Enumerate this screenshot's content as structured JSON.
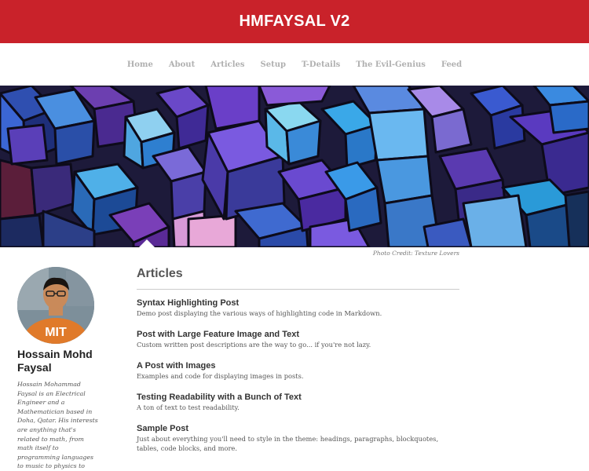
{
  "header": {
    "site_title": "HMFAYSAL V2"
  },
  "nav": {
    "items": [
      {
        "label": "Home"
      },
      {
        "label": "About"
      },
      {
        "label": "Articles"
      },
      {
        "label": "Setup"
      },
      {
        "label": "T-Details"
      },
      {
        "label": "The Evil-Genius"
      },
      {
        "label": "Feed"
      }
    ]
  },
  "hero": {
    "credit": "Photo Credit: Texture Lovers"
  },
  "author": {
    "name": "Hossain Mohd Faysal",
    "bio": "Hossain Mohammad Faysal is an Electrical Engineer and a Mathematician based in Doha, Qatar. His interests are anything that's related to math, from math itself to programming languages to music to physics to engineering to philosophy."
  },
  "main": {
    "section_title": "Articles",
    "posts": [
      {
        "title": "Syntax Highlighting Post",
        "excerpt": "Demo post displaying the various ways of highlighting code in Markdown."
      },
      {
        "title": "Post with Large Feature Image and Text",
        "excerpt": "Custom written post descriptions are the way to go... if you're not lazy."
      },
      {
        "title": "A Post with Images",
        "excerpt": "Examples and code for displaying images in posts."
      },
      {
        "title": "Testing Readability with a Bunch of Text",
        "excerpt": "A ton of text to test readability."
      },
      {
        "title": "Sample Post",
        "excerpt": "Just about everything you'll need to style in the theme: headings, paragraphs, blockquotes, tables, code blocks, and more."
      }
    ]
  },
  "colors": {
    "brand_red": "#c9222a",
    "nav_text": "#b0b0b0"
  }
}
